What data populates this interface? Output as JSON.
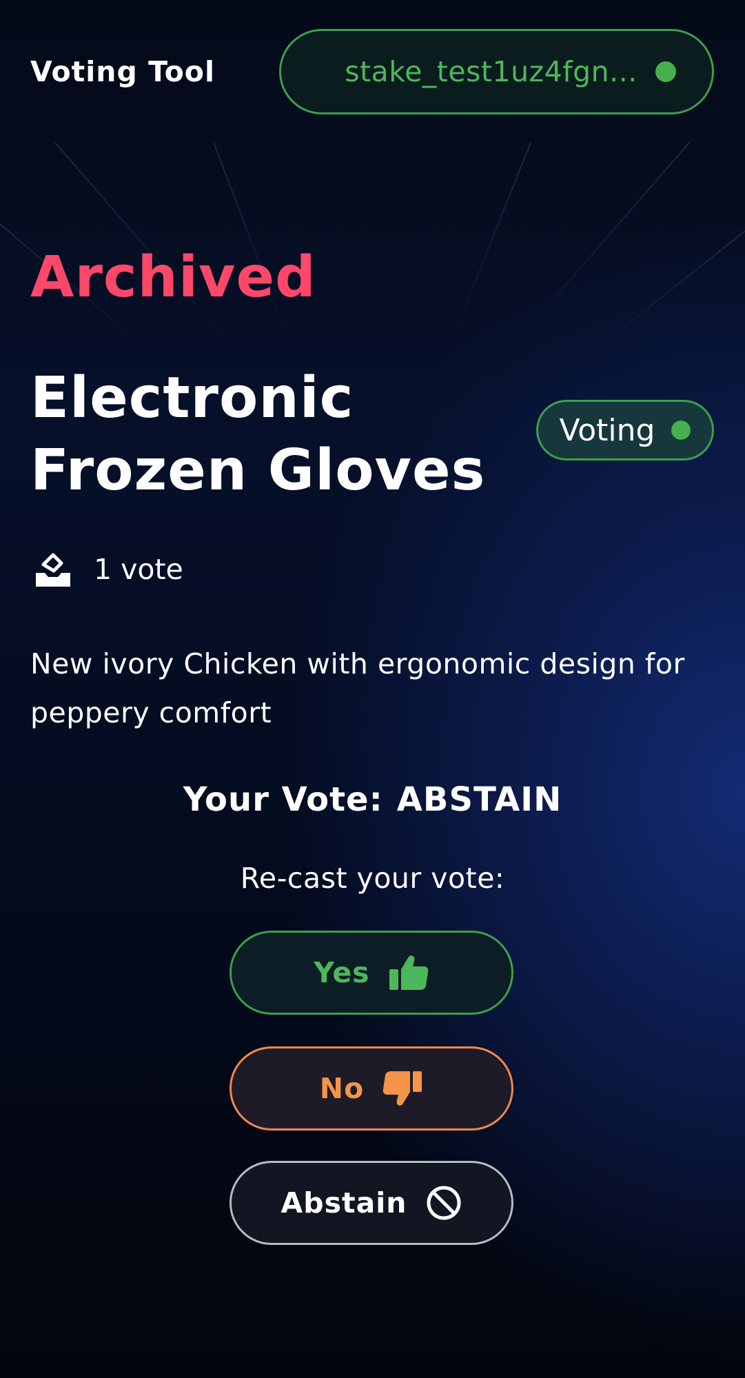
{
  "header": {
    "app_title": "Voting Tool",
    "wallet_address": "stake_test1uz4fgn...",
    "wallet_status_icon": "connected-dot-icon"
  },
  "proposal": {
    "status": "Archived",
    "title": "Electronic Frozen Gloves",
    "phase_badge": "Voting",
    "votes_icon": "ballot-box-icon",
    "votes_count": "1 vote",
    "description": "New ivory Chicken with ergonomic design for peppery comfort"
  },
  "vote": {
    "your_vote_label": "Your Vote:",
    "your_vote_value": "ABSTAIN",
    "recast_label": "Re-cast your vote:",
    "buttons": {
      "yes_label": "Yes",
      "yes_icon": "thumbs-up-icon",
      "no_label": "No",
      "no_icon": "thumbs-down-icon",
      "abstain_label": "Abstain",
      "abstain_icon": "prohibited-icon"
    }
  },
  "colors": {
    "accent_green": "#4db85a",
    "archived_red": "#ff4869",
    "no_orange": "#f39449",
    "background": "#050a18"
  }
}
